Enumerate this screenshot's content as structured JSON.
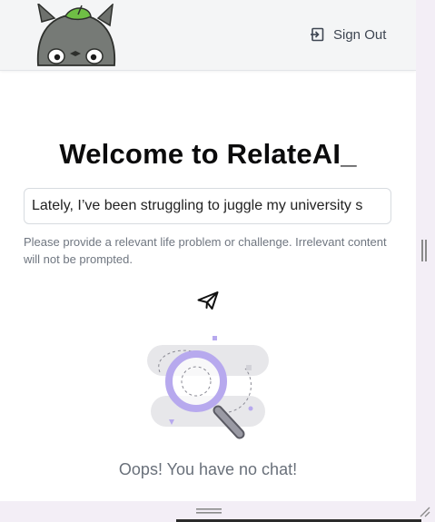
{
  "header": {
    "logo_name": "totoro-logo",
    "signout_label": "Sign Out"
  },
  "main": {
    "title": "Welcome to RelateAI_",
    "prompt_value": "Lately, I’ve been struggling to juggle my university s",
    "hint": "Please provide a relevant life problem or challenge. Irrelevant content will not be prompted.",
    "send_icon": "paper-plane-icon",
    "empty_state_icon": "magnifier-illustration",
    "empty_message": "Oops! You have no chat!"
  },
  "colors": {
    "header_bg": "#f4f5f6",
    "page_bg": "#f3eef6",
    "title": "#0b0b0c",
    "hint": "#6f7680",
    "illustration_accent": "#b7a9ee"
  }
}
